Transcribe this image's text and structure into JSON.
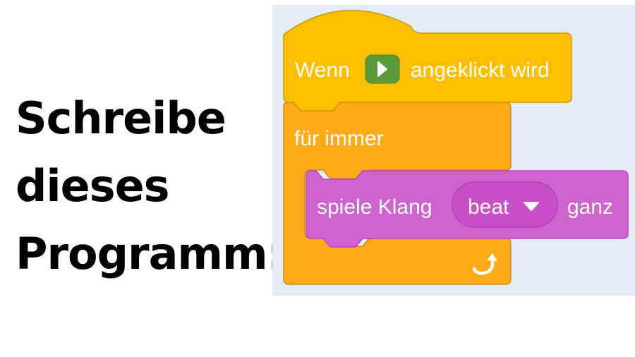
{
  "instruction": {
    "line1": "Schreibe",
    "line2": "dieses",
    "line3": "Programm:"
  },
  "blocks": {
    "hat": {
      "text_before": "Wenn",
      "flag_icon": "green-flag-icon",
      "text_after": "angeklickt wird"
    },
    "forever": {
      "label": "für immer",
      "loop_icon": "loop-arrow-icon"
    },
    "sound": {
      "text_before": "spiele Klang",
      "dropdown_value": "beat",
      "dropdown_icon": "dropdown-arrow-icon",
      "text_after": "ganz"
    }
  },
  "colors": {
    "events": "#ffbf00",
    "events_border": "#cc9900",
    "control": "#ffab19",
    "control_border": "#cf8b17",
    "sound": "#cf63cf",
    "sound_border": "#bd42bd",
    "sound_field": "#c94fc9",
    "flag_button": "#5b9a3a",
    "workspace": "#e4ecf6"
  }
}
